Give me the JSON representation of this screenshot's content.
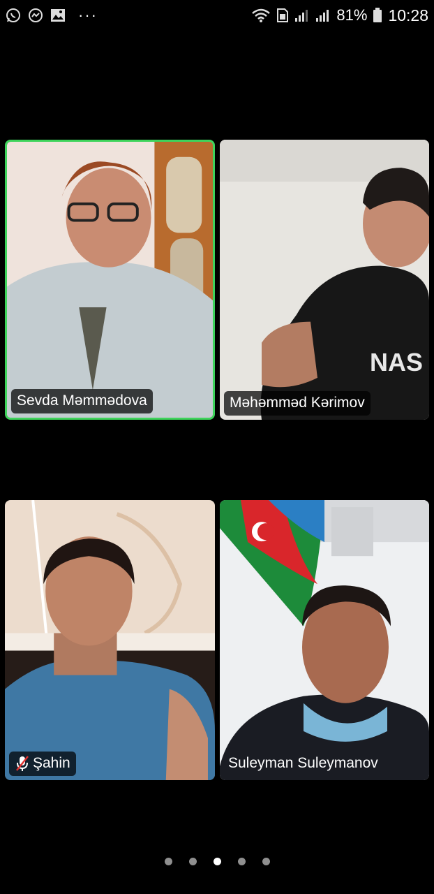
{
  "status_bar": {
    "icons_left": [
      "whatsapp-icon",
      "messenger-icon",
      "gallery-icon"
    ],
    "more": "···",
    "battery_percent": "81%",
    "time": "10:28"
  },
  "participants": [
    {
      "name": "Sevda Məmmədova",
      "active_speaker": true,
      "muted": false
    },
    {
      "name": "Məhəmməd Kərimov",
      "active_speaker": false,
      "muted": false
    },
    {
      "name": "Şahin",
      "active_speaker": false,
      "muted": true
    },
    {
      "name": "Suleyman Suleymanov",
      "active_speaker": false,
      "muted": false
    }
  ],
  "pager": {
    "pages": 5,
    "current": 3
  },
  "colors": {
    "active_border": "#3ed35b",
    "background": "#000000"
  }
}
